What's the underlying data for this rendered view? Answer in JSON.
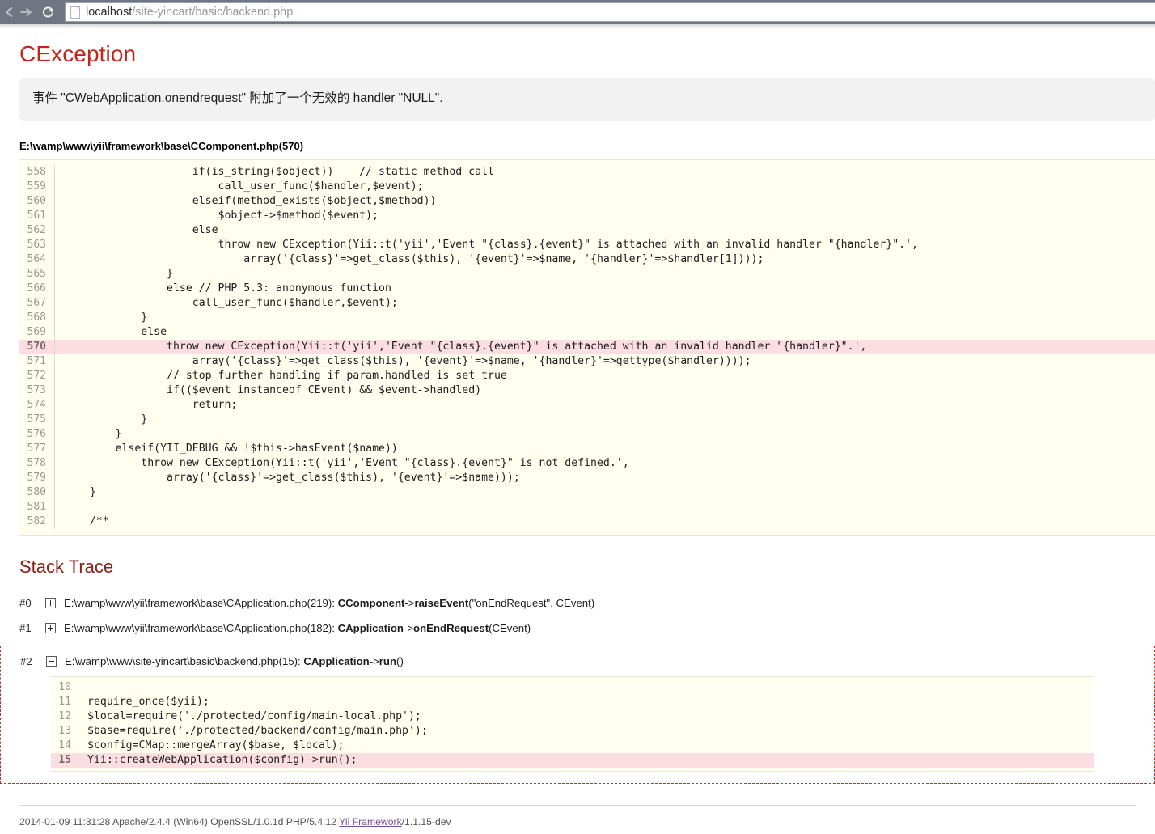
{
  "browser": {
    "back_icon": "arrow-left-icon",
    "forward_icon": "arrow-right-icon",
    "reload_icon": "reload-icon",
    "page_icon": "page-document-icon",
    "url_host": "localhost",
    "url_path": "/site-yincart/basic/backend.php",
    "url_full": "localhost/site-yincart/basic/backend.php"
  },
  "error": {
    "title": "CException",
    "message": "事件 \"CWebApplication.onendrequest\" 附加了一个无效的 handler \"NULL\".",
    "source_file": "E:\\wamp\\www\\yii\\framework\\base\\CComponent.php(570)",
    "highlight_line": 570
  },
  "code": {
    "first_line": 558,
    "lines": [
      {
        "n": "558",
        "t": "                    if(is_string($object))    // static method call",
        "hl": false
      },
      {
        "n": "559",
        "t": "                        call_user_func($handler,$event);",
        "hl": false
      },
      {
        "n": "560",
        "t": "                    elseif(method_exists($object,$method))",
        "hl": false
      },
      {
        "n": "561",
        "t": "                        $object->$method($event);",
        "hl": false
      },
      {
        "n": "562",
        "t": "                    else",
        "hl": false
      },
      {
        "n": "563",
        "t": "                        throw new CException(Yii::t('yii','Event \"{class}.{event}\" is attached with an invalid handler \"{handler}\".',",
        "hl": false
      },
      {
        "n": "564",
        "t": "                            array('{class}'=>get_class($this), '{event}'=>$name, '{handler}'=>$handler[1])));",
        "hl": false
      },
      {
        "n": "565",
        "t": "                }",
        "hl": false
      },
      {
        "n": "566",
        "t": "                else // PHP 5.3: anonymous function",
        "hl": false
      },
      {
        "n": "567",
        "t": "                    call_user_func($handler,$event);",
        "hl": false
      },
      {
        "n": "568",
        "t": "            }",
        "hl": false
      },
      {
        "n": "569",
        "t": "            else",
        "hl": false
      },
      {
        "n": "570",
        "t": "                throw new CException(Yii::t('yii','Event \"{class}.{event}\" is attached with an invalid handler \"{handler}\".',",
        "hl": true
      },
      {
        "n": "571",
        "t": "                    array('{class}'=>get_class($this), '{event}'=>$name, '{handler}'=>gettype($handler))));",
        "hl": false
      },
      {
        "n": "572",
        "t": "                // stop further handling if param.handled is set true",
        "hl": false
      },
      {
        "n": "573",
        "t": "                if(($event instanceof CEvent) && $event->handled)",
        "hl": false
      },
      {
        "n": "574",
        "t": "                    return;",
        "hl": false
      },
      {
        "n": "575",
        "t": "            }",
        "hl": false
      },
      {
        "n": "576",
        "t": "        }",
        "hl": false
      },
      {
        "n": "577",
        "t": "        elseif(YII_DEBUG && !$this->hasEvent($name))",
        "hl": false
      },
      {
        "n": "578",
        "t": "            throw new CException(Yii::t('yii','Event \"{class}.{event}\" is not defined.',",
        "hl": false
      },
      {
        "n": "579",
        "t": "                array('{class}'=>get_class($this), '{event}'=>$name)));",
        "hl": false
      },
      {
        "n": "580",
        "t": "    }",
        "hl": false
      },
      {
        "n": "581",
        "t": "",
        "hl": false
      },
      {
        "n": "582",
        "t": "    /**",
        "hl": false
      }
    ]
  },
  "stack_trace": {
    "title": "Stack Trace",
    "frames": [
      {
        "num": "#0",
        "toggle": "plus",
        "file": "E:\\wamp\\www\\yii\\framework\\base\\CApplication.php(219): ",
        "class": "CComponent",
        "arrow": "->",
        "method": "raiseEvent",
        "args": "(\"onEndRequest\", CEvent)",
        "expanded": false
      },
      {
        "num": "#1",
        "toggle": "plus",
        "file": "E:\\wamp\\www\\yii\\framework\\base\\CApplication.php(182): ",
        "class": "CApplication",
        "arrow": "->",
        "method": "onEndRequest",
        "args": "(CEvent)",
        "expanded": false
      },
      {
        "num": "#2",
        "toggle": "minus",
        "file": "E:\\wamp\\www\\site-yincart\\basic\\backend.php(15): ",
        "class": "CApplication",
        "arrow": "->",
        "method": "run",
        "args": "()",
        "expanded": true
      }
    ],
    "expanded_code": {
      "highlight_line": 15,
      "lines": [
        {
          "n": "10",
          "t": "",
          "hl": false
        },
        {
          "n": "11",
          "t": "require_once($yii);",
          "hl": false
        },
        {
          "n": "12",
          "t": "$local=require('./protected/config/main-local.php');",
          "hl": false
        },
        {
          "n": "13",
          "t": "$base=require('./protected/backend/config/main.php');",
          "hl": false
        },
        {
          "n": "14",
          "t": "$config=CMap::mergeArray($base, $local);",
          "hl": false
        },
        {
          "n": "15",
          "t": "Yii::createWebApplication($config)->run();",
          "hl": true
        }
      ]
    }
  },
  "footer": {
    "prefix": "2014-01-09 11:31:28 Apache/2.4.4 (Win64) OpenSSL/1.0.1d PHP/5.4.12 ",
    "link": "Yii Framework",
    "suffix": "/1.1.15-dev"
  },
  "colors": {
    "error_title": "#c3241b",
    "stack_title": "#8a1f14",
    "code_bg": "#fffff0",
    "highlight_bg": "#fbdde2",
    "message_bg": "#f2f2f2",
    "dashed_border": "#a23c34",
    "link": "#7a4f9a",
    "chrome_bg": "#6f7681"
  }
}
